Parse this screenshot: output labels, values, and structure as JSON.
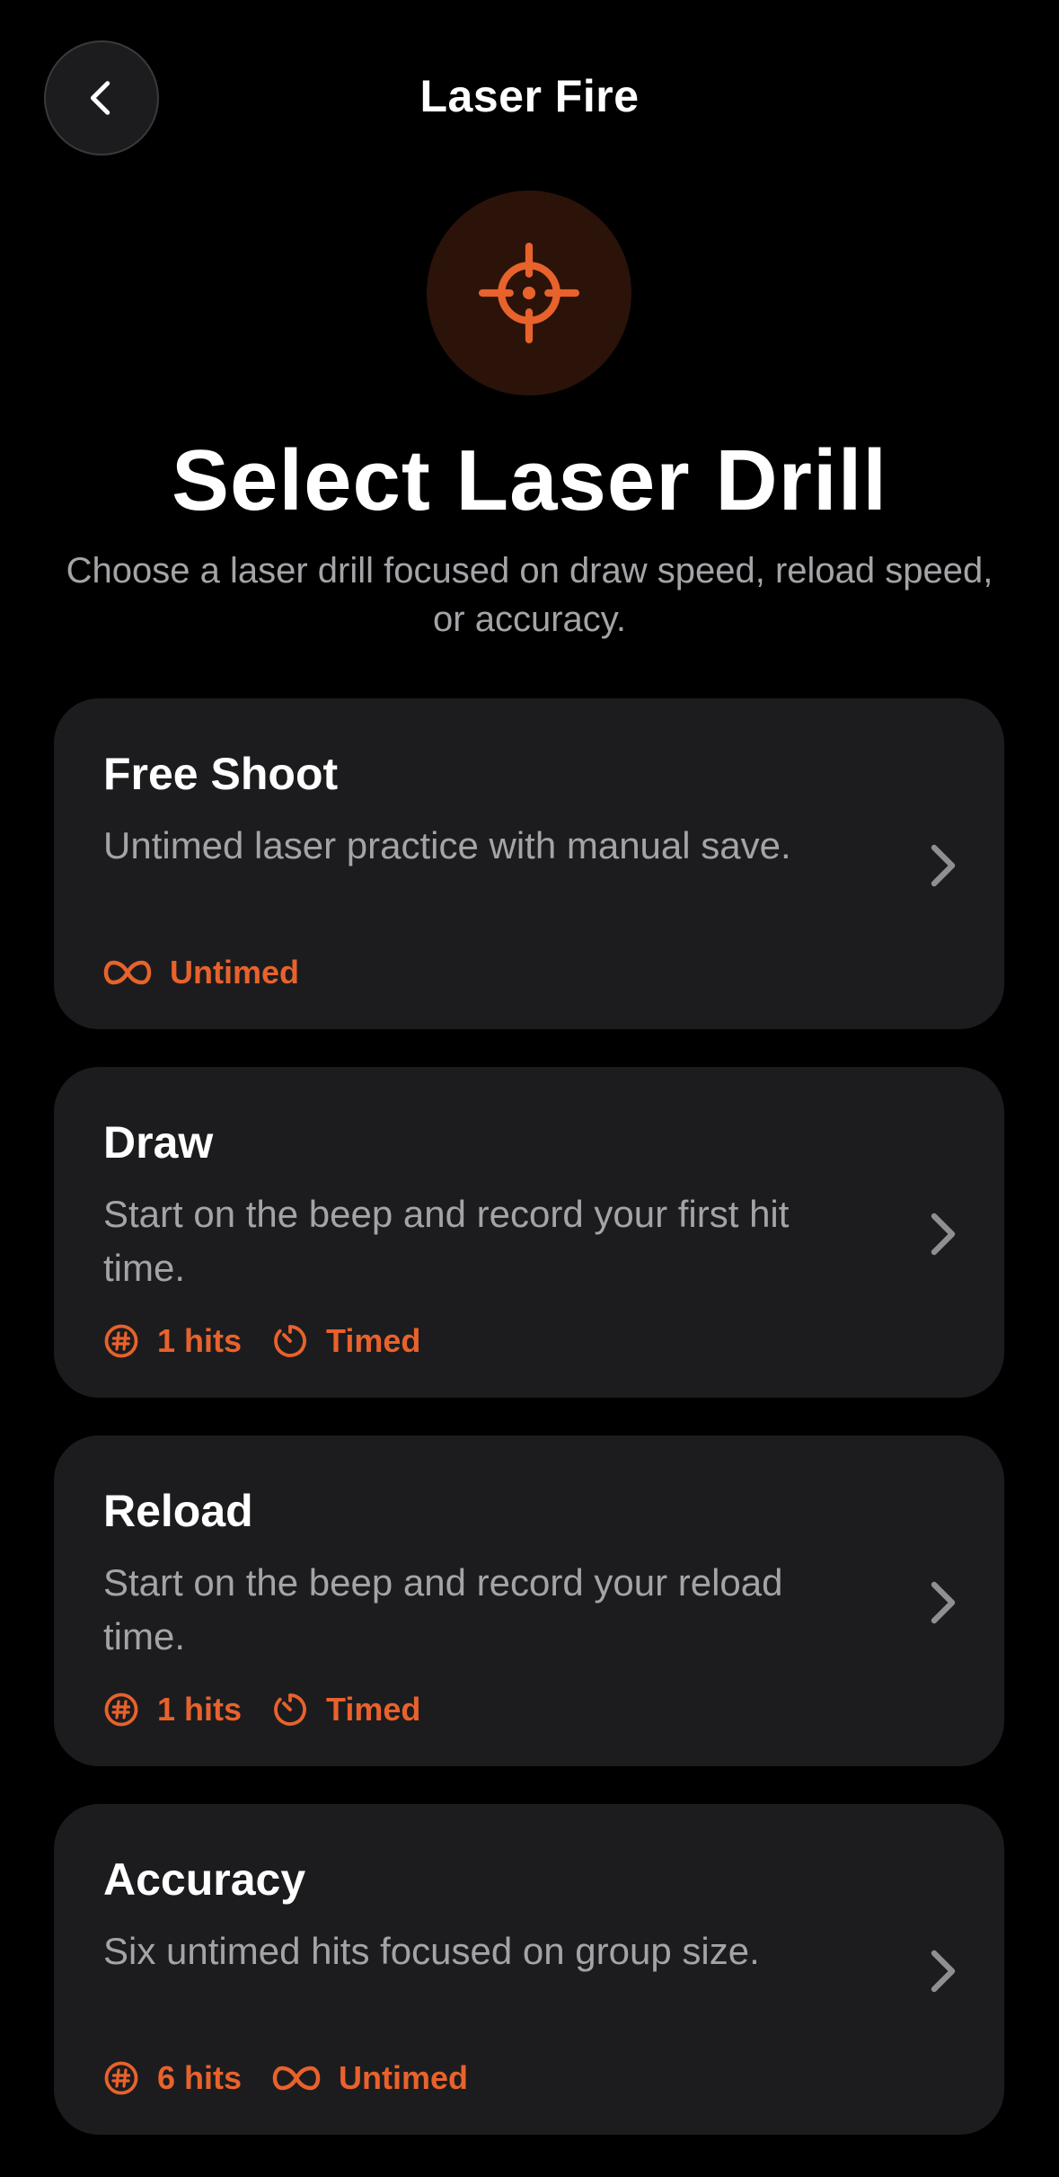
{
  "header": {
    "title": "Laser Fire",
    "back_icon": "chevron-left-icon"
  },
  "hero": {
    "icon": "crosshair-icon",
    "accent": "#e8622c",
    "title": "Select Laser Drill",
    "subtitle": "Choose a laser drill focused on draw speed, reload speed, or accuracy."
  },
  "drills": [
    {
      "title": "Free Shoot",
      "description": "Untimed laser practice with manual save.",
      "meta": [
        {
          "icon": "infinity-icon",
          "label": "Untimed"
        }
      ]
    },
    {
      "title": "Draw",
      "description": "Start on the beep and record your first hit time.",
      "meta": [
        {
          "icon": "hash-icon",
          "label": "1 hits"
        },
        {
          "icon": "timer-icon",
          "label": "Timed"
        }
      ]
    },
    {
      "title": "Reload",
      "description": "Start on the beep and record your reload time.",
      "meta": [
        {
          "icon": "hash-icon",
          "label": "1 hits"
        },
        {
          "icon": "timer-icon",
          "label": "Timed"
        }
      ]
    },
    {
      "title": "Accuracy",
      "description": "Six untimed hits focused on group size.",
      "meta": [
        {
          "icon": "hash-icon",
          "label": "6 hits"
        },
        {
          "icon": "infinity-icon",
          "label": "Untimed"
        }
      ]
    }
  ],
  "colors": {
    "background": "#000000",
    "card": "#1c1c1e",
    "accent": "#e8622c",
    "secondary_text": "#a4a4a8"
  }
}
